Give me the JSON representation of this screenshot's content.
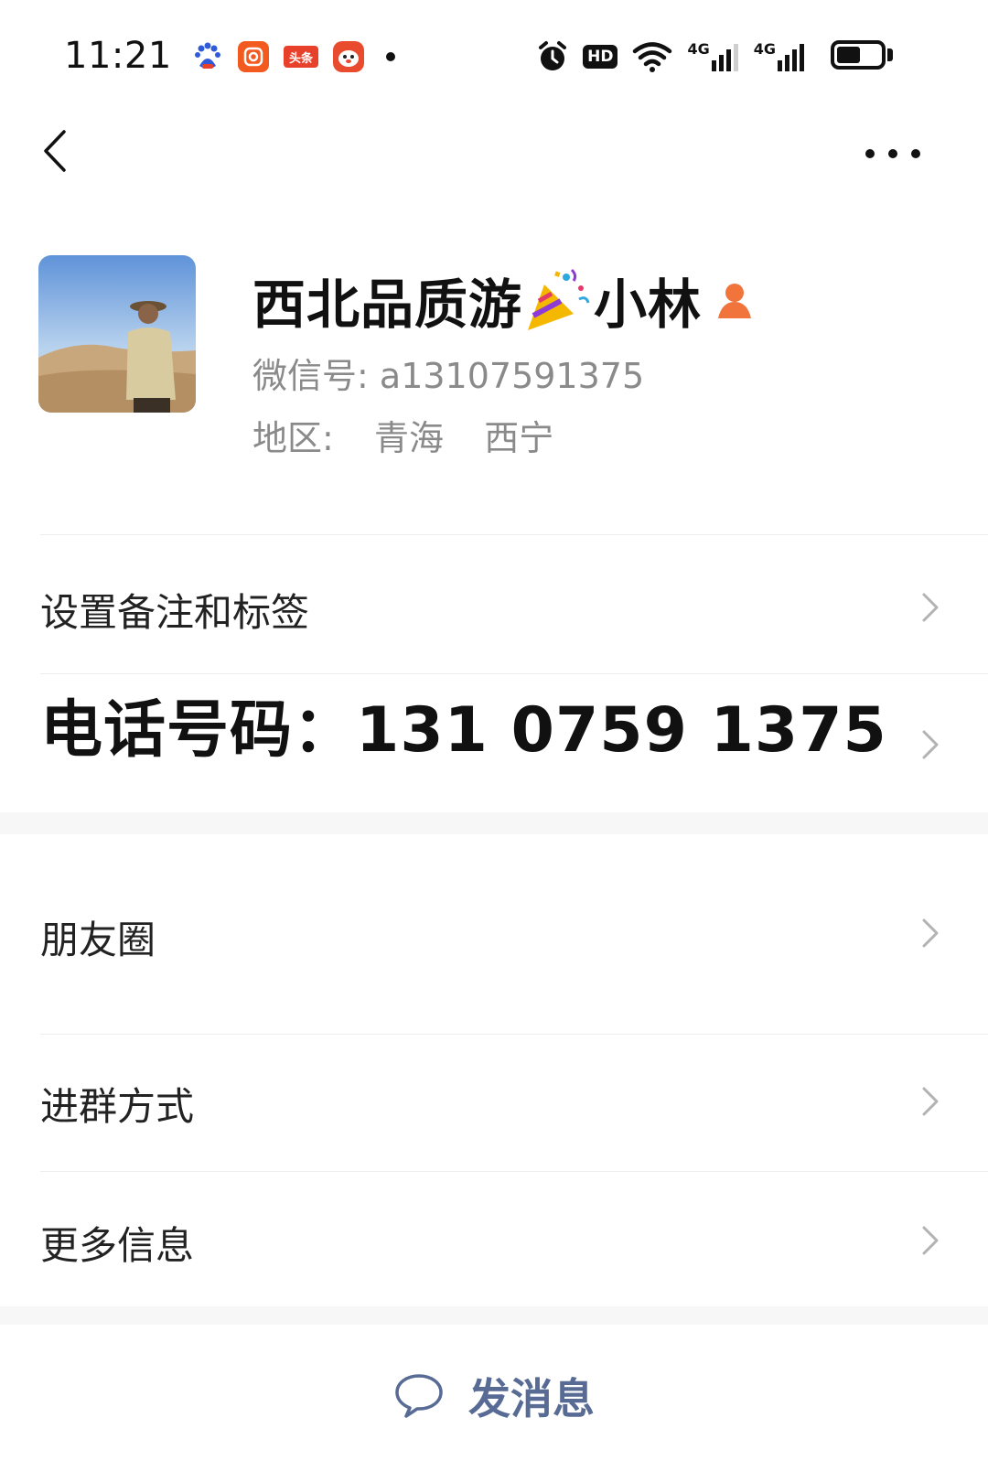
{
  "status_bar": {
    "time": "11:21",
    "notification_apps": [
      "baidu-icon",
      "camera-app-icon",
      "toutiao-icon",
      "face-app-icon"
    ],
    "toutiao_text": "头条",
    "system_icons": [
      "alarm-icon",
      "hd-voice-icon",
      "wifi-icon",
      "signal-4g-icon",
      "signal-4g-icon",
      "battery-icon"
    ],
    "hd_label": "HD",
    "network_1": "4G",
    "network_2": "4G",
    "battery_level": 0.55
  },
  "nav": {
    "back_icon": "chevron-left-icon",
    "more_icon": "more-dots-icon"
  },
  "profile": {
    "name_part1": "西北品质游",
    "name_emoji": "party-popper-icon",
    "name_part2": "小林",
    "gender_icon": "female-icon",
    "wechat_id_label": "微信号:",
    "wechat_id_value": "a13107591375",
    "region_label": "地区:",
    "region_province": "青海",
    "region_city": "西宁"
  },
  "rows": {
    "remark": "设置备注和标签",
    "phone_label": "电话号码：",
    "phone_value": "131 0759 1375",
    "moments": "朋友圈",
    "group_join": "进群方式",
    "more_info": "更多信息"
  },
  "actions": {
    "send_message": "发消息",
    "send_icon": "chat-bubble-icon"
  },
  "colors": {
    "link_blue": "#576b95",
    "secondary_gray": "#8a8a8a",
    "accent_orange": "#f25a1f"
  }
}
